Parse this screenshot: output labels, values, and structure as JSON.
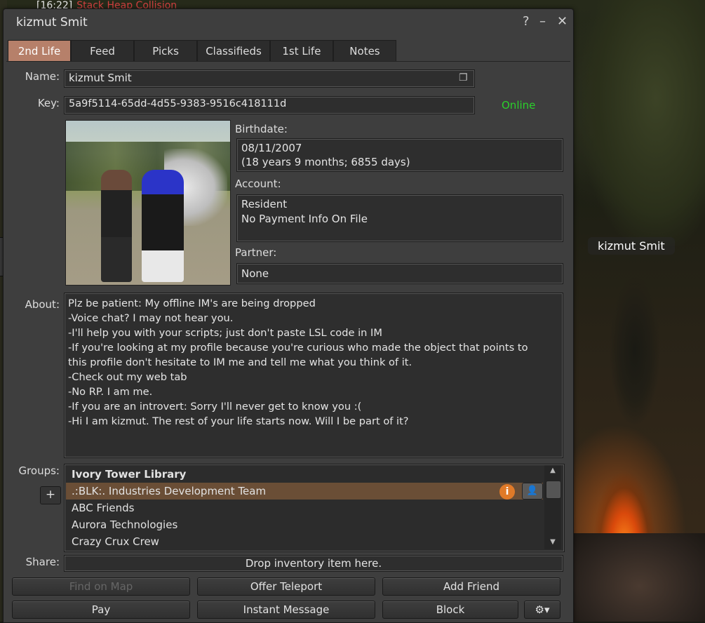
{
  "chat": {
    "time": "[16:22]",
    "name": "Stack Heap Collision"
  },
  "world": {
    "avatar_tag": "kizmut Smit"
  },
  "floater": {
    "title": "kizmut Smit",
    "help": "?",
    "minimize": "–",
    "close": "✕"
  },
  "tabs": [
    {
      "label": "2nd Life",
      "active": true
    },
    {
      "label": "Feed"
    },
    {
      "label": "Picks"
    },
    {
      "label": "Classifieds"
    },
    {
      "label": "1st Life"
    },
    {
      "label": "Notes"
    }
  ],
  "profile": {
    "name_label": "Name:",
    "name": "kizmut Smit",
    "key_label": "Key:",
    "key": "5a9f5114-65dd-4d55-9383-9516c418111d",
    "status": "Online",
    "birthdate_label": "Birthdate:",
    "birthdate": "08/11/2007",
    "age": "(18 years 9 months; 6855 days)",
    "account_label": "Account:",
    "account_type": "Resident",
    "payment_info": "No Payment Info On File",
    "partner_label": "Partner:",
    "partner": "None",
    "about_label": "About:",
    "about_lines": [
      "Plz be patient: My offline IM's are being dropped",
      "-Voice chat? I may not hear you.",
      "-I'll help you with your scripts; just don't paste LSL code in IM",
      "-If you're looking at my profile because you're curious who made the object that points to",
      "this profile don't hesitate to IM me and tell me what you think of it.",
      "-Check out my web tab",
      "-No RP. I am me.",
      "-If you are an introvert: Sorry I'll never get to know you :(",
      "-Hi I am kizmut. The rest of your life starts now. Will I be part of it?"
    ],
    "groups_label": "Groups:",
    "groups_add": "+",
    "groups": [
      "Ivory Tower Library",
      ".:BLK:. Industries Development Team",
      "ABC Friends",
      "Aurora Technologies",
      "Crazy Crux Crew"
    ],
    "share_label": "Share:",
    "share_drop": "Drop inventory item here."
  },
  "buttons": {
    "find_on_map": "Find on Map",
    "offer_teleport": "Offer Teleport",
    "add_friend": "Add Friend",
    "pay": "Pay",
    "instant_message": "Instant Message",
    "block": "Block",
    "gear": "⚙▾"
  },
  "colors": {
    "online": "#2bd02b",
    "active_tab": "#b6806a",
    "selected_row": "#6a4e36",
    "info_badge": "#e07a28"
  }
}
